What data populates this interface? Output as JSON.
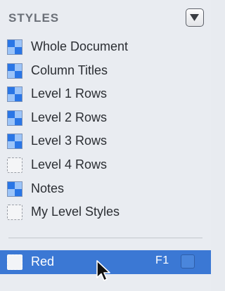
{
  "header": {
    "title": "STYLES",
    "menu_icon": "triangle-down-icon"
  },
  "styles": [
    {
      "label": "Whole Document",
      "swatch": "filled"
    },
    {
      "label": "Column Titles",
      "swatch": "filled"
    },
    {
      "label": "Level 1 Rows",
      "swatch": "filled"
    },
    {
      "label": "Level 2 Rows",
      "swatch": "filled"
    },
    {
      "label": "Level 3 Rows",
      "swatch": "filled"
    },
    {
      "label": "Level 4 Rows",
      "swatch": "empty"
    },
    {
      "label": "Notes",
      "swatch": "filled"
    },
    {
      "label": "My Level Styles",
      "swatch": "empty"
    }
  ],
  "named_style": {
    "label": "Red",
    "shortcut": "F1",
    "selected": true
  },
  "colors": {
    "selection": "#3b78d4",
    "panel_background": "#e9ecf1",
    "swatch_dark": "#2a76e6",
    "swatch_light": "#9cc4f8"
  }
}
